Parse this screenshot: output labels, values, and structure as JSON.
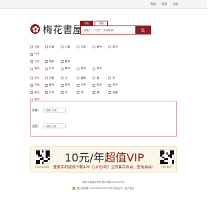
{
  "topbar": {
    "links": [
      "帮助",
      "登录",
      "注册"
    ]
  },
  "header": {
    "site_name": "梅花書屋"
  },
  "search": {
    "tabs": [
      "书名",
      "作者"
    ],
    "placeholder": "请输入一个文字（支持繁体）"
  },
  "filters": {
    "rows": [
      [
        "书体",
        "行楷",
        "小楷",
        "行草",
        "隶书",
        "草书"
      ],
      [
        "行书"
      ],
      [
        "汉字",
        "简体",
        "繁体"
      ],
      [
        "楷书",
        "行书",
        "草书",
        "隶书",
        "篆书"
      ],
      [
        "年代",
        "先秦",
        "汉",
        "魏晋",
        "唐",
        "宋"
      ],
      [
        "书体",
        "隶书",
        "草书",
        "行书",
        "楷书",
        "篆书"
      ],
      [
        "隶书",
        "行书",
        "宋",
        "明",
        "清",
        "民国"
      ],
      [
        "楷书"
      ]
    ]
  },
  "form": {
    "author_label": "作者：",
    "author_placeholder": "请输入作者",
    "title_label": "出处：",
    "title_placeholder": "请输入出处"
  },
  "banner": {
    "title_pre": "10元/年",
    "title_accent": "超值VIP",
    "subtitle": "登录手机版或下载APP【10元/年】立即集字自由，查询自由！",
    "qr_left_caption": "扫码关注梅花书屋",
    "qr_right_caption": "扫码下载APP"
  },
  "footer": {
    "line1": "梅花书屋版权所有  豫ICP备15012229号",
    "line2": "豫公网安备 41090202122229号  商务合作 | 用户协议"
  }
}
